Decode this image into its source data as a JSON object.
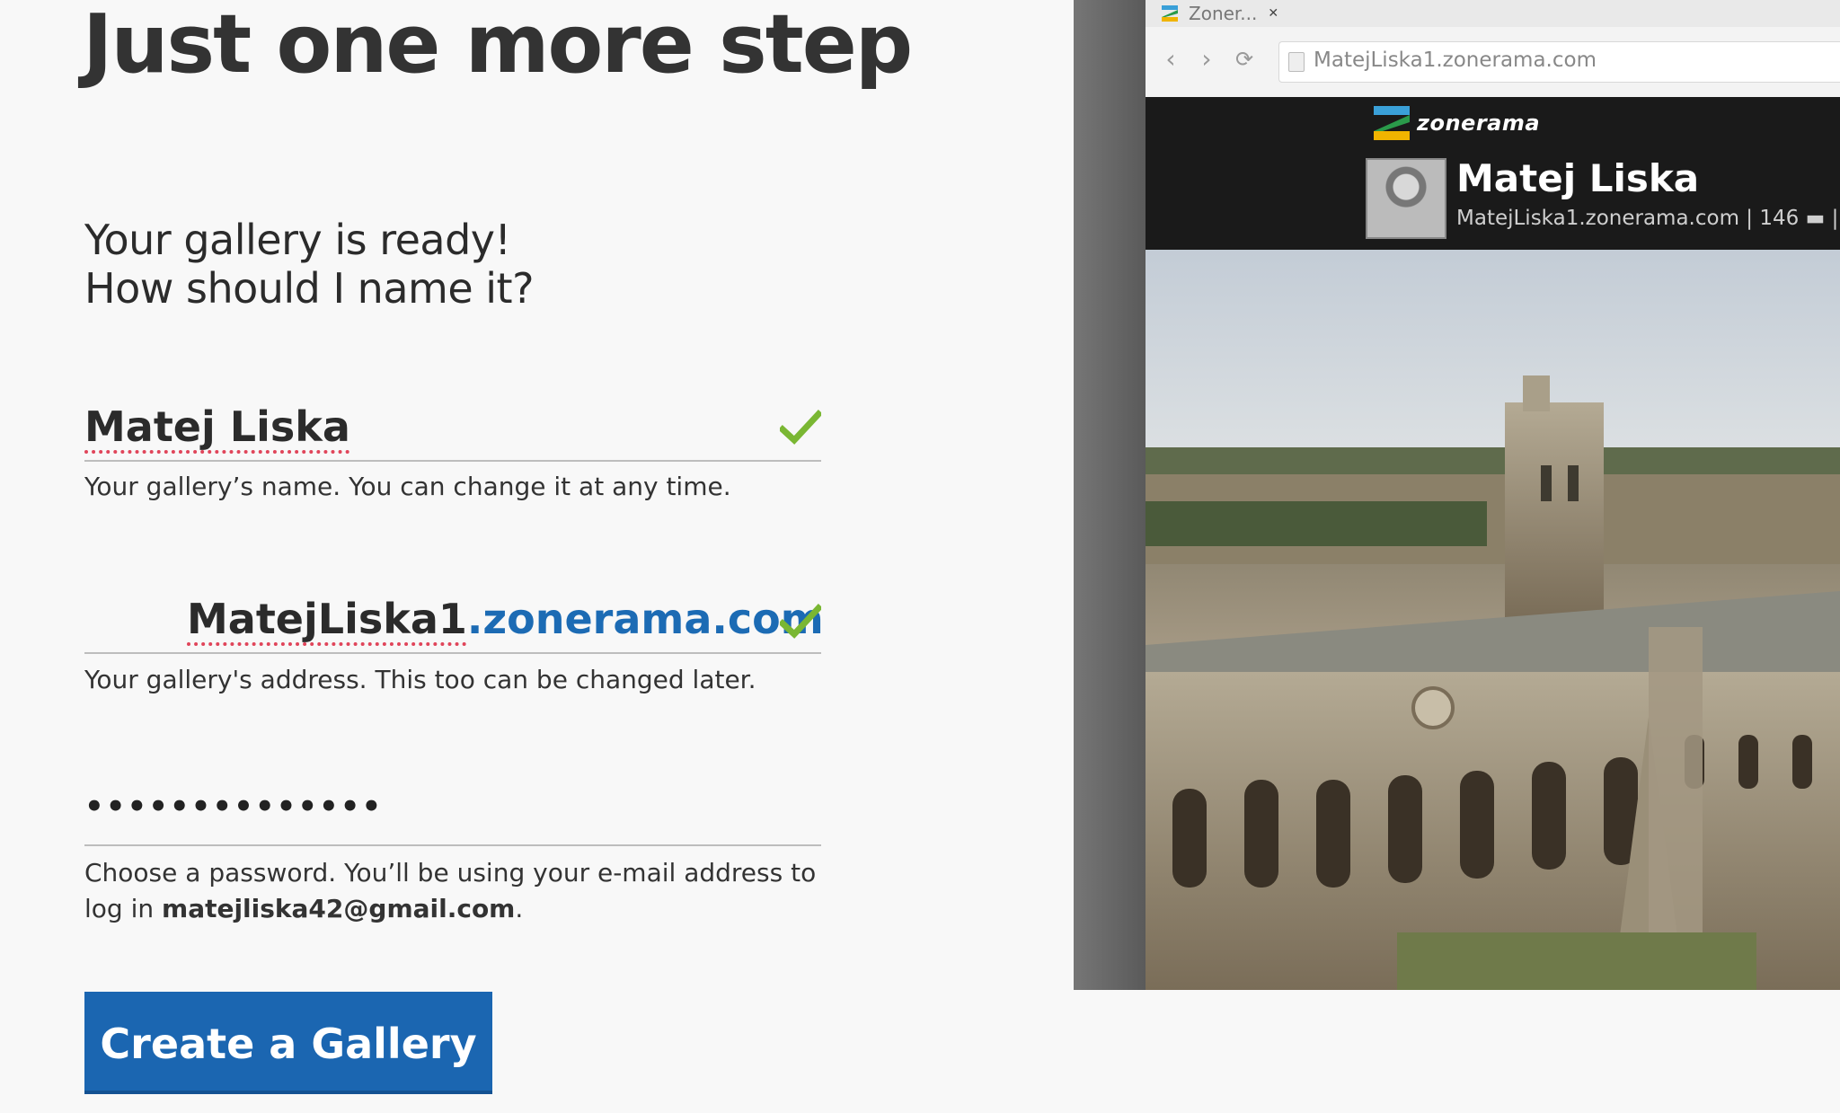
{
  "heading": "Just one more step",
  "subheading_line1": "Your gallery is ready!",
  "subheading_line2": "How should I name it?",
  "name_field": {
    "value": "Matej Liska",
    "hint": "Your gallery’s name. You can change it at any time."
  },
  "address_field": {
    "subdomain": "MatejLiska1",
    "domain": ".zonerama.com",
    "hint": "Your gallery's address. This too can be changed later."
  },
  "password_field": {
    "masked_value": "••••••••••••••",
    "hint_prefix": "Choose a password. You’ll be using your e-mail address to log in ",
    "email": "matejliska42@gmail.com",
    "hint_suffix": "."
  },
  "create_button_label": "Create a Gallery",
  "preview": {
    "tab_title": "Zoner...",
    "url": "MatejLiska1.zonerama.com",
    "site_logo": "zonerama",
    "profile_name": "Matej Liska",
    "profile_meta": "MatejLiska1.zonerama.com | 146 ▬ |"
  },
  "colors": {
    "accent_blue": "#1b66b1",
    "domain_blue": "#1c6bb4",
    "check_green": "#7ab733"
  }
}
